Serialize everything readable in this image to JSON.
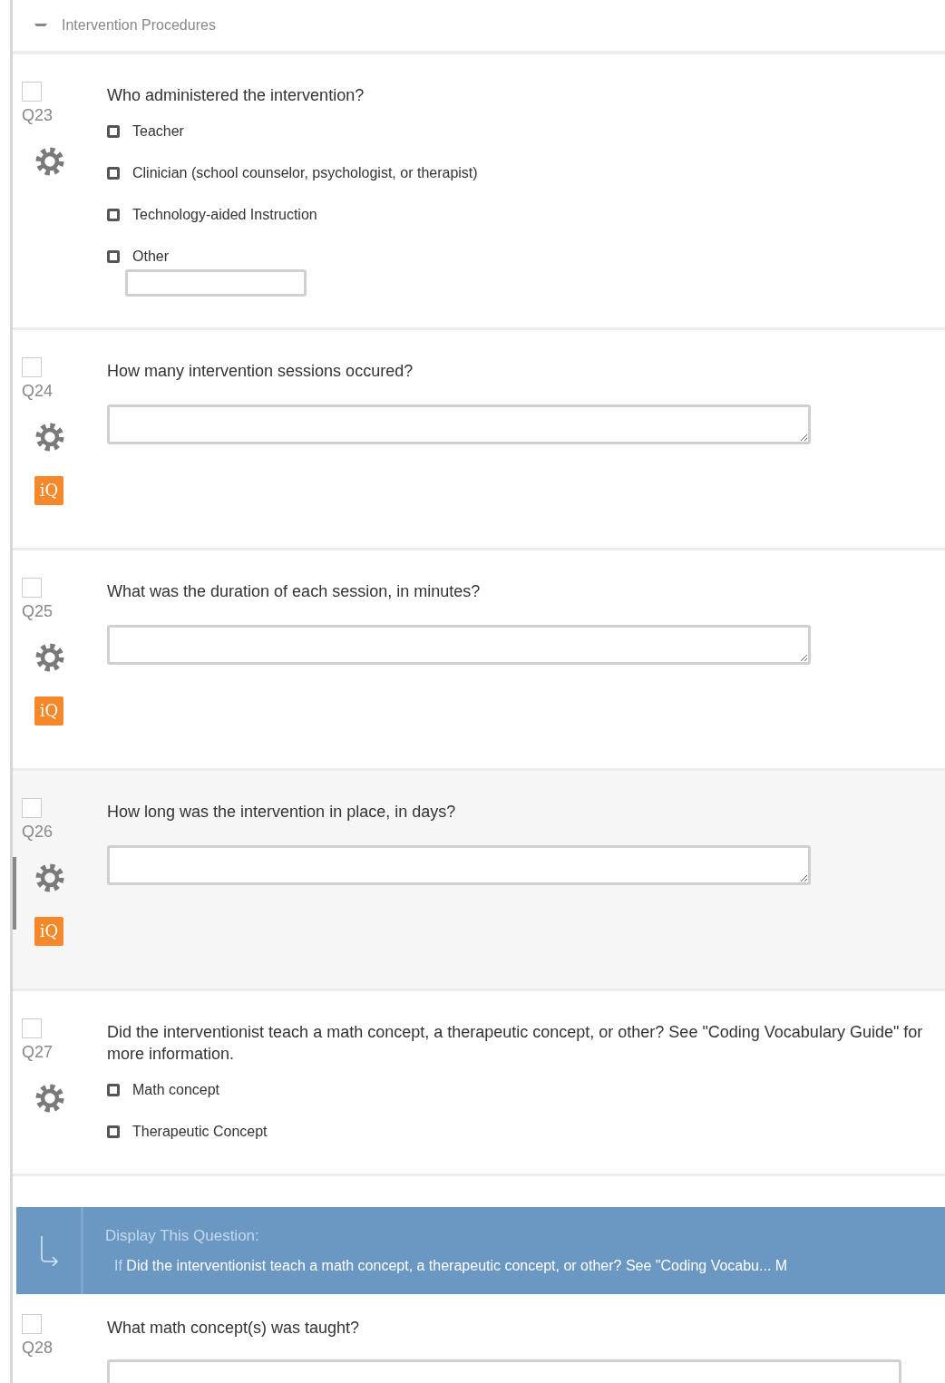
{
  "section": {
    "title": "Intervention Procedures",
    "expanded": true
  },
  "questions": [
    {
      "number": "Q23",
      "checked": false,
      "selected": false,
      "gear": true,
      "kind": "choice",
      "text": "Who administered the intervention?",
      "choices": [
        {
          "label": "Teacher",
          "checked": false,
          "text_entry": false
        },
        {
          "label": "Clinician (school counselor, psychologist, or therapist)",
          "checked": false,
          "text_entry": false
        },
        {
          "label": "Technology-aided Instruction",
          "checked": false,
          "text_entry": false
        },
        {
          "label": "Other",
          "checked": false,
          "text_entry": true
        }
      ]
    },
    {
      "number": "Q24",
      "checked": false,
      "selected": false,
      "gear": true,
      "iq": "iQ",
      "kind": "text",
      "text": "How many intervention sessions occured?"
    },
    {
      "number": "Q25",
      "checked": false,
      "selected": false,
      "gear": true,
      "iq": "iQ",
      "kind": "text",
      "text": "What was the duration of each session, in minutes?"
    },
    {
      "number": "Q26",
      "checked": false,
      "selected": true,
      "gear": true,
      "iq": "iQ",
      "kind": "text",
      "text": "How long was the intervention in place, in days?"
    },
    {
      "number": "Q27",
      "checked": false,
      "selected": false,
      "gear": true,
      "kind": "choice",
      "text": "Did the interventionist teach a math concept, a therapeutic concept, or other? See \"Coding Vocabulary Guide\" for more information.",
      "choices": [
        {
          "label": "Math concept",
          "checked": false,
          "text_entry": false
        },
        {
          "label": "Therapeutic Concept",
          "checked": false,
          "text_entry": false
        }
      ]
    },
    {
      "number": "Q28",
      "checked": false,
      "selected": false,
      "gear": false,
      "kind": "text",
      "text": "What math concept(s) was taught?",
      "display_logic": {
        "title": "Display This Question:",
        "prefix": "If",
        "condition": "Did the interventionist teach a math concept, a therapeutic concept, or other? See \"Coding Vocabu... M"
      }
    }
  ]
}
